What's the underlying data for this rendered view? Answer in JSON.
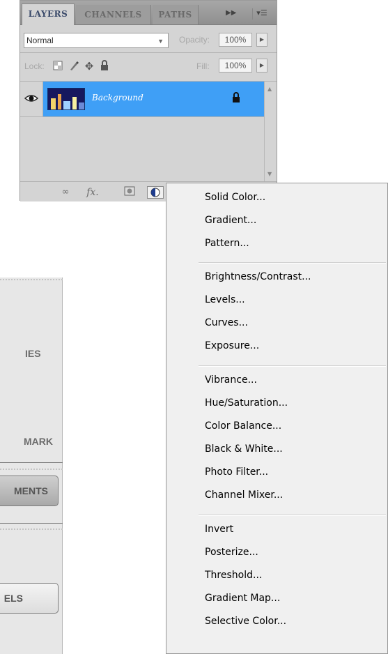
{
  "layers_panel": {
    "tabs": [
      "LAYERS",
      "CHANNELS",
      "PATHS"
    ],
    "collapse_icon": "double-right-arrow-icon",
    "menu_icon": "panel-menu-icon",
    "blend_mode": "Normal",
    "opacity_label": "Opacity:",
    "opacity_value": "100%",
    "lock_label": "Lock:",
    "fill_label": "Fill:",
    "fill_value": "100%",
    "layers": [
      {
        "name": "Background",
        "visible": true,
        "locked": true,
        "selected": true
      }
    ],
    "footer_icons": [
      "link-icon",
      "fx-icon",
      "mask-icon",
      "adjustment-layer-icon"
    ],
    "selection_color": "#3f9ff6"
  },
  "side_panel": {
    "labels": [
      "IES",
      "MARK"
    ],
    "buttons": [
      "MENTS",
      "ELS"
    ]
  },
  "adjustment_menu": {
    "groups": [
      [
        "Solid Color...",
        "Gradient...",
        "Pattern..."
      ],
      [
        "Brightness/Contrast...",
        "Levels...",
        "Curves...",
        "Exposure..."
      ],
      [
        "Vibrance...",
        "Hue/Saturation...",
        "Color Balance...",
        "Black & White...",
        "Photo Filter...",
        "Channel Mixer..."
      ],
      [
        "Invert",
        "Posterize...",
        "Threshold...",
        "Gradient Map...",
        "Selective Color..."
      ]
    ]
  }
}
